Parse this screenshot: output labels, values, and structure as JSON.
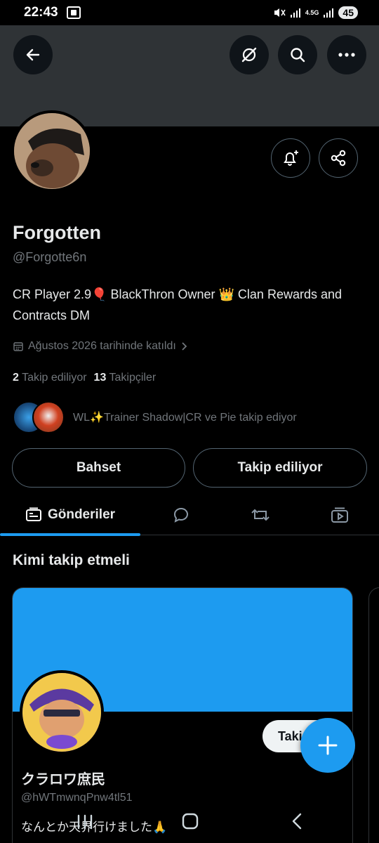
{
  "status_bar": {
    "time": "22:43",
    "network": "4.5G",
    "battery": "45"
  },
  "profile": {
    "name": "Forgotten",
    "handle": "@Forgotte6n",
    "bio": "CR Player 2.9🎈 BlackThron Owner 👑 Clan Rewards and Contracts DM",
    "joined": "Ağustos 2026 tarihinde katıldı",
    "following_count": "2",
    "following_label": "Takip ediliyor",
    "followers_count": "13",
    "followers_label": "Takipçiler",
    "followed_by_text": "WL✨Trainer Shadow|CR ve Pie takip ediyor"
  },
  "actions": {
    "mention_label": "Bahset",
    "following_label": "Takip ediliyor"
  },
  "tabs": [
    {
      "label": "Gönderiler",
      "icon": "posts-icon"
    },
    {
      "icon": "reply-icon"
    },
    {
      "icon": "repost-icon"
    },
    {
      "icon": "media-icon"
    }
  ],
  "who_to_follow": {
    "title": "Kimi takip etmeli",
    "card": {
      "name": "クラロワ庶民",
      "handle": "@hWTmwnqPnw4tl51",
      "bio": "なんとか天界行けました🙏",
      "follow_label": "Takip"
    }
  },
  "colors": {
    "accent": "#1d9bf0",
    "banner": "#2f3336",
    "muted": "#71767b"
  }
}
